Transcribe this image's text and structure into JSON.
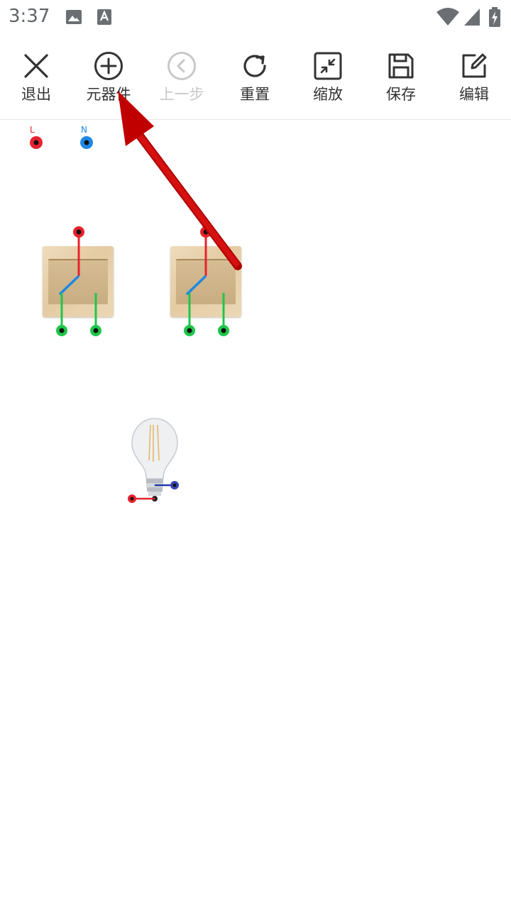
{
  "status_bar": {
    "time": "3:37",
    "left_icons": [
      "image-icon",
      "font-a-icon"
    ],
    "right_icons": [
      "wifi-icon",
      "cell-signal-icon",
      "battery-charging-icon"
    ]
  },
  "toolbar": {
    "exit_label": "退出",
    "components_label": "元器件",
    "undo_label": "上一步",
    "reset_label": "重置",
    "zoom_label": "缩放",
    "save_label": "保存",
    "edit_label": "编辑"
  },
  "canvas": {
    "terminals": {
      "live_label": "L",
      "neutral_label": "N"
    },
    "components": [
      "switch-1",
      "switch-2",
      "light-bulb"
    ]
  },
  "colors": {
    "live_wire": "#e8222e",
    "neutral_wire": "#1e88e5",
    "switch_output": "#1fc64a",
    "arrow": "#c00000",
    "icon": "#333333",
    "disabled": "#c8c8c8"
  }
}
